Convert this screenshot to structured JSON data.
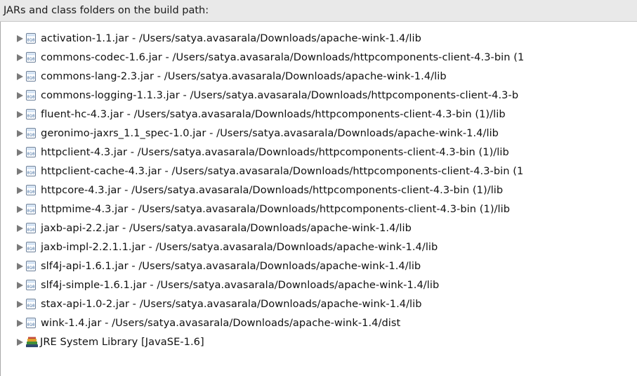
{
  "header": {
    "title": "JARs and class folders on the build path:"
  },
  "items": [
    {
      "label": "activation-1.1.jar - /Users/satya.avasarala/Downloads/apache-wink-1.4/lib",
      "icon": "jar-file-icon"
    },
    {
      "label": "commons-codec-1.6.jar - /Users/satya.avasarala/Downloads/httpcomponents-client-4.3-bin (1",
      "icon": "jar-file-icon"
    },
    {
      "label": "commons-lang-2.3.jar - /Users/satya.avasarala/Downloads/apache-wink-1.4/lib",
      "icon": "jar-file-icon"
    },
    {
      "label": "commons-logging-1.1.3.jar - /Users/satya.avasarala/Downloads/httpcomponents-client-4.3-b",
      "icon": "jar-file-icon"
    },
    {
      "label": "fluent-hc-4.3.jar - /Users/satya.avasarala/Downloads/httpcomponents-client-4.3-bin (1)/lib",
      "icon": "jar-file-icon"
    },
    {
      "label": "geronimo-jaxrs_1.1_spec-1.0.jar - /Users/satya.avasarala/Downloads/apache-wink-1.4/lib",
      "icon": "jar-file-icon"
    },
    {
      "label": "httpclient-4.3.jar - /Users/satya.avasarala/Downloads/httpcomponents-client-4.3-bin (1)/lib",
      "icon": "jar-file-icon"
    },
    {
      "label": "httpclient-cache-4.3.jar - /Users/satya.avasarala/Downloads/httpcomponents-client-4.3-bin (1",
      "icon": "jar-file-icon"
    },
    {
      "label": "httpcore-4.3.jar - /Users/satya.avasarala/Downloads/httpcomponents-client-4.3-bin (1)/lib",
      "icon": "jar-file-icon"
    },
    {
      "label": "httpmime-4.3.jar - /Users/satya.avasarala/Downloads/httpcomponents-client-4.3-bin (1)/lib",
      "icon": "jar-file-icon"
    },
    {
      "label": "jaxb-api-2.2.jar - /Users/satya.avasarala/Downloads/apache-wink-1.4/lib",
      "icon": "jar-file-icon"
    },
    {
      "label": "jaxb-impl-2.2.1.1.jar - /Users/satya.avasarala/Downloads/apache-wink-1.4/lib",
      "icon": "jar-file-icon"
    },
    {
      "label": "slf4j-api-1.6.1.jar - /Users/satya.avasarala/Downloads/apache-wink-1.4/lib",
      "icon": "jar-file-icon"
    },
    {
      "label": "slf4j-simple-1.6.1.jar - /Users/satya.avasarala/Downloads/apache-wink-1.4/lib",
      "icon": "jar-file-icon"
    },
    {
      "label": "stax-api-1.0-2.jar - /Users/satya.avasarala/Downloads/apache-wink-1.4/lib",
      "icon": "jar-file-icon"
    },
    {
      "label": "wink-1.4.jar - /Users/satya.avasarala/Downloads/apache-wink-1.4/dist",
      "icon": "jar-file-icon"
    },
    {
      "label": "JRE System Library [JavaSE-1.6]",
      "icon": "library-icon"
    }
  ]
}
